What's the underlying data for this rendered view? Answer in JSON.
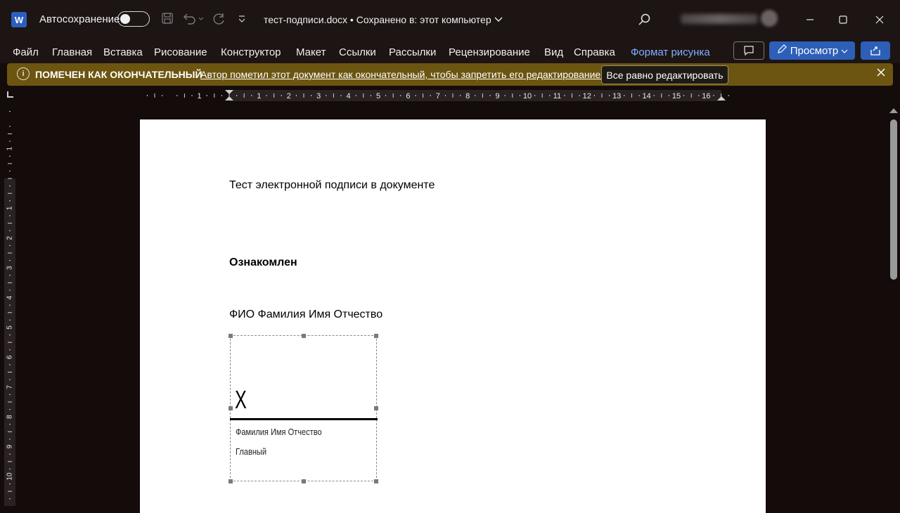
{
  "titlebar": {
    "app_icon_letter": "W",
    "autosave_label": "Автосохранение",
    "document_title": "тест-подписи.docx • Сохранено в: этот компьютер",
    "window_buttons": [
      "minimize-icon",
      "maximize-icon",
      "close-icon"
    ]
  },
  "menu": {
    "items": [
      "Файл",
      "Главная",
      "Вставка",
      "Рисование",
      "Конструктор",
      "Макет",
      "Ссылки",
      "Рассылки",
      "Рецензирование",
      "Вид",
      "Справка"
    ],
    "accent_item": "Формат рисунка",
    "view_button": "Просмотр"
  },
  "infobar": {
    "title": "ПОМЕЧЕН КАК ОКОНЧАТЕЛЬНЫЙ",
    "message": "Автор пометил этот документ как окончательный, чтобы запретить его редактирование.",
    "edit_button": "Все равно редактировать"
  },
  "ruler": {
    "h_numbers": [
      "1",
      "1",
      "2",
      "3",
      "4",
      "5",
      "6",
      "7",
      "8",
      "9",
      "10",
      "11",
      "12",
      "13",
      "14",
      "15",
      "16"
    ],
    "v_numbers": [
      "1",
      "1",
      "2",
      "3",
      "4",
      "5",
      "6",
      "7",
      "8",
      "9",
      "10"
    ]
  },
  "document": {
    "line1": "Тест электронной подписи в документе",
    "line2": "Ознакомлен",
    "line3": "ФИО Фамилия Имя Отчество",
    "signature": {
      "mark": "X",
      "signer_name": "Фамилия Имя Отчество",
      "signer_title": "Главный"
    }
  },
  "colors": {
    "background": "#140b0b",
    "titlebar": "#1d1414",
    "infobar": "#6b5510",
    "accent_blue": "#2d5fb8",
    "accent_text": "#7fb0ff"
  }
}
